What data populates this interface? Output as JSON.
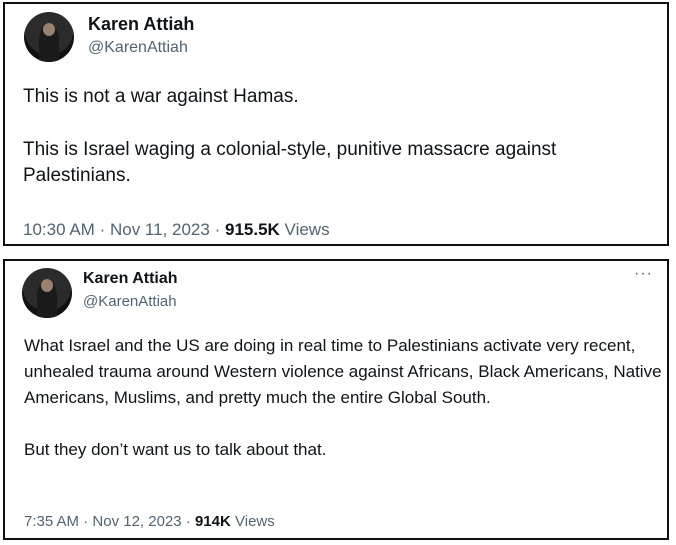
{
  "tweets": [
    {
      "author_name": "Karen Attiah",
      "author_handle": "@KarenAttiah",
      "paragraphs": [
        "This is not a war against Hamas.",
        "This is Israel waging a colonial-style, punitive massacre against Palestinians."
      ],
      "time": "10:30 AM",
      "date": "Nov 11, 2023",
      "views_count": "915.5K",
      "views_label": "Views"
    },
    {
      "author_name": "Karen Attiah",
      "author_handle": "@KarenAttiah",
      "more_icon": "···",
      "paragraphs": [
        "What Israel and the US are doing in real time to Palestinians activate very recent, unhealed trauma around Western violence against Africans, Black Americans, Native Americans, Muslims, and pretty much the entire Global South.",
        "But they don’t want us to talk about that."
      ],
      "time": "7:35 AM",
      "date": "Nov 12, 2023",
      "views_count": "914K",
      "views_label": "Views"
    }
  ],
  "separator": "·",
  "colors": {
    "text": "#0f1419",
    "secondary": "#536471",
    "border": "#111111"
  }
}
